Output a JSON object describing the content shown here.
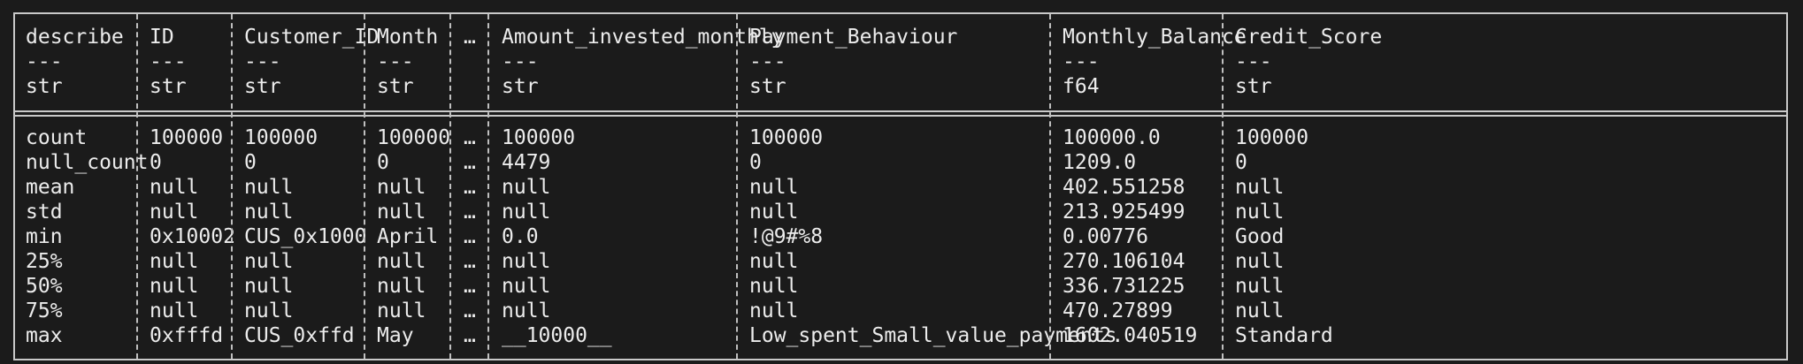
{
  "table": {
    "columns": [
      {
        "name": "describe",
        "sep": "---",
        "dtype": "str",
        "cells": [
          "count",
          "null_count",
          "mean",
          "std",
          "min",
          "25%",
          "50%",
          "75%",
          "max"
        ]
      },
      {
        "name": "ID",
        "sep": "---",
        "dtype": "str",
        "cells": [
          "100000",
          "0",
          "null",
          "null",
          "0x10002",
          "null",
          "null",
          "null",
          "0xfffd"
        ]
      },
      {
        "name": "Customer_ID",
        "sep": "---",
        "dtype": "str",
        "cells": [
          "100000",
          "0",
          "null",
          "null",
          "CUS_0x1000",
          "null",
          "null",
          "null",
          "CUS_0xffd"
        ]
      },
      {
        "name": "Month",
        "sep": "---",
        "dtype": "str",
        "cells": [
          "100000",
          "0",
          "null",
          "null",
          "April",
          "null",
          "null",
          "null",
          "May"
        ]
      },
      {
        "name": "…",
        "sep": "",
        "dtype": "",
        "cells": [
          "…",
          "…",
          "…",
          "…",
          "…",
          "…",
          "…",
          "…",
          "…"
        ]
      },
      {
        "name": "Amount_invested_monthly",
        "sep": "---",
        "dtype": "str",
        "cells": [
          "100000",
          "4479",
          "null",
          "null",
          "0.0",
          "null",
          "null",
          "null",
          "__10000__"
        ]
      },
      {
        "name": "Payment_Behaviour",
        "sep": "---",
        "dtype": "str",
        "cells": [
          "100000",
          "0",
          "null",
          "null",
          "!@9#%8",
          "null",
          "null",
          "null",
          "Low_spent_Small_value_payments"
        ]
      },
      {
        "name": "Monthly_Balance",
        "sep": "---",
        "dtype": "f64",
        "cells": [
          "100000.0",
          "1209.0",
          "402.551258",
          "213.925499",
          "0.00776",
          "270.106104",
          "336.731225",
          "470.27899",
          "1602.040519"
        ]
      },
      {
        "name": "Credit_Score",
        "sep": "---",
        "dtype": "str",
        "cells": [
          "100000",
          "0",
          "null",
          "null",
          "Good",
          "null",
          "null",
          "null",
          "Standard"
        ]
      }
    ]
  }
}
